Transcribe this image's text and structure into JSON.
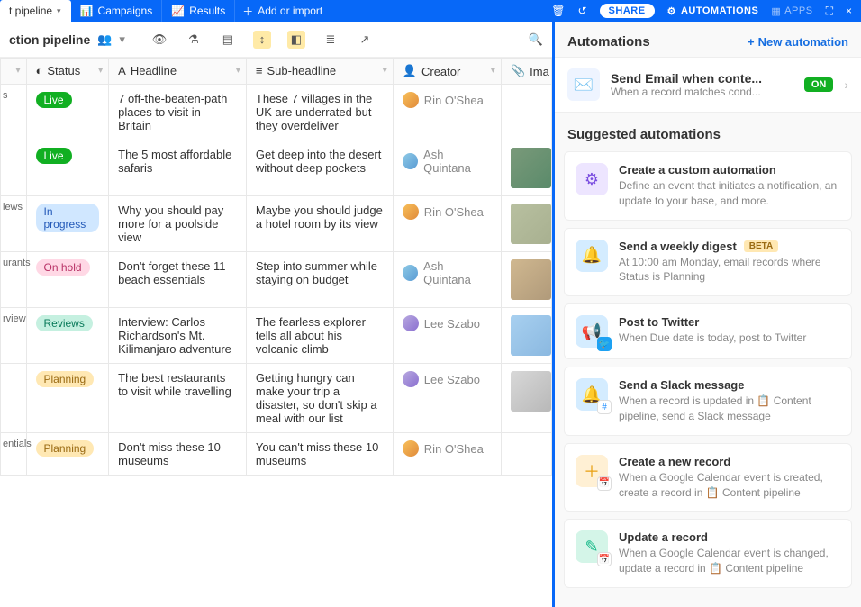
{
  "topbar": {
    "tabs": [
      {
        "label": "t pipeline",
        "active": true
      },
      {
        "label": "Campaigns",
        "active": false
      },
      {
        "label": "Results",
        "active": false
      }
    ],
    "add_label": "Add or import",
    "share_label": "SHARE",
    "automations_label": "AUTOMATIONS",
    "apps_label": "APPS"
  },
  "viewbar": {
    "name": "ction pipeline"
  },
  "columns": {
    "status": "Status",
    "headline": "Headline",
    "subheadline": "Sub-headline",
    "creator": "Creator",
    "image": "Ima"
  },
  "rows": [
    {
      "partial": "s",
      "status": "Live",
      "sclass": "b-live",
      "headline": "7 off-the-beaten-path places to visit in Britain",
      "sub": "These 7 villages in the UK are underrated but they overdeliver",
      "creator": "Rin O'Shea",
      "av": "av1",
      "thumb": ""
    },
    {
      "partial": "",
      "status": "Live",
      "sclass": "b-live",
      "headline": "The 5 most affordable safaris",
      "sub": "Get deep into the desert without deep pockets",
      "creator": "Ash Quintana",
      "av": "av2",
      "thumb": "t2"
    },
    {
      "partial": "iews",
      "status": "In progress",
      "sclass": "b-prog",
      "headline": "Why you should pay more for a poolside view",
      "sub": "Maybe you should judge a hotel room by its view",
      "creator": "Rin O'Shea",
      "av": "av1",
      "thumb": "t1"
    },
    {
      "partial": "urants",
      "status": "On hold",
      "sclass": "b-hold",
      "headline": "Don't forget these 11 beach essentials",
      "sub": "Step into summer while staying on budget",
      "creator": "Ash Quintana",
      "av": "av2",
      "thumb": "t3"
    },
    {
      "partial": "rview",
      "status": "Reviews",
      "sclass": "b-rev",
      "headline": "Interview: Carlos Richardson's Mt. Kilimanjaro adventure",
      "sub": "The fearless explorer tells all about his volcanic climb",
      "creator": "Lee Szabo",
      "av": "av3",
      "thumb": "t4"
    },
    {
      "partial": "",
      "status": "Planning",
      "sclass": "b-plan",
      "headline": "The best restaurants to visit while travelling",
      "sub": "Getting hungry can make your trip a disaster, so don't skip a meal with our list",
      "creator": "Lee Szabo",
      "av": "av3",
      "thumb": "t5"
    },
    {
      "partial": "entials",
      "status": "Planning",
      "sclass": "b-plan",
      "headline": "Don't miss these 10 museums",
      "sub": "You can't miss these 10 museums",
      "creator": "Rin O'Shea",
      "av": "av1",
      "thumb": ""
    }
  ],
  "panel": {
    "title": "Automations",
    "new_label": "New automation",
    "active": {
      "name": "Send Email when conte...",
      "sub": "When a record matches cond...",
      "status": "ON"
    },
    "suggested_title": "Suggested automations",
    "suggestions": [
      {
        "name": "Create a custom automation",
        "desc": "Define an event that initiates a notification, an update to your base, and more.",
        "ico": "si1",
        "sub": ""
      },
      {
        "name": "Send a weekly digest",
        "desc": "At 10:00 am Monday, email records where Status is Planning",
        "ico": "si2",
        "sub": "",
        "beta": true
      },
      {
        "name": "Post to Twitter",
        "desc": "When Due date is today, post to Twitter",
        "ico": "si3",
        "sub": "sb-tw"
      },
      {
        "name": "Send a Slack message",
        "desc": "When a record is updated in 📋 Content pipeline, send a Slack message",
        "ico": "si4",
        "sub": "sb-sl"
      },
      {
        "name": "Create a new record",
        "desc": "When a Google Calendar event is created, create a record in 📋 Content pipeline",
        "ico": "si5",
        "sub": "sb-gc"
      },
      {
        "name": "Update a record",
        "desc": "When a Google Calendar event is changed, update a record in 📋 Content pipeline",
        "ico": "si6",
        "sub": "sb-gc"
      }
    ]
  }
}
